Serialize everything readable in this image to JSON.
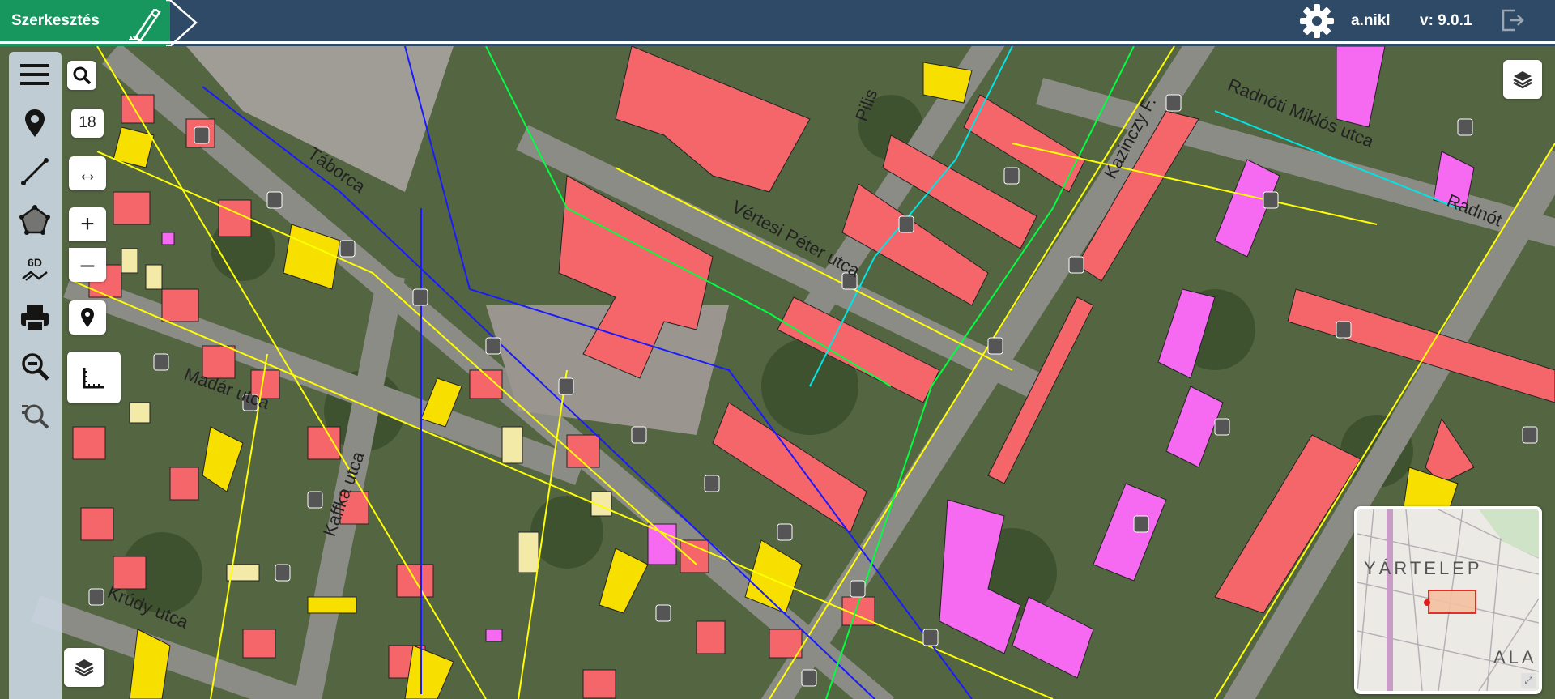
{
  "header": {
    "mode_label": "Szerkesztés",
    "user_name": "a.nikl",
    "version": "v: 9.0.1",
    "icons": {
      "mode": "pencil-ruler-icon",
      "settings": "gear-icon",
      "logout": "logout-icon"
    },
    "colors": {
      "bar": "#2f4a66",
      "mode_tab": "#17965e"
    }
  },
  "toolbar": {
    "tools": [
      {
        "name": "menu",
        "icon": "hamburger-menu-icon"
      },
      {
        "name": "point",
        "icon": "map-pin-icon"
      },
      {
        "name": "line",
        "icon": "line-draw-icon"
      },
      {
        "name": "polygon",
        "icon": "polygon-draw-icon"
      },
      {
        "name": "6d",
        "icon": "6d-icon",
        "label": "6D"
      },
      {
        "name": "print",
        "icon": "printer-icon"
      },
      {
        "name": "zoom-search",
        "icon": "zoom-search-icon"
      },
      {
        "name": "zoom-filter",
        "icon": "zoom-filter-icon"
      }
    ]
  },
  "controls": {
    "zoom_level": "18",
    "icons": {
      "search": "search-icon",
      "pan": "horizontal-arrows-icon",
      "zoom_in": "plus-icon",
      "zoom_out": "minus-icon",
      "locate": "location-pin-icon",
      "measure": "ruler-icon",
      "layers": "layers-icon"
    },
    "zoom_in_label": "+",
    "zoom_out_label": "–",
    "pan_label": "↔"
  },
  "map": {
    "street_labels": [
      "Táborca",
      "Vértesi Péter utca",
      "Pilis",
      "Kazinczy F.",
      "Radnóti Miklós utca",
      "Radnót",
      "Madár utca",
      "Kaffka utca",
      "Krúdy utca"
    ],
    "colors": {
      "building": "#f4666a",
      "public_building": "#f56af1",
      "yellow_building": "#f7e000",
      "pale_building": "#f3eaa8",
      "gas": "#ffff00",
      "water": "#1a1aff",
      "telecom": "#00ff40",
      "cable": "#00e5e5"
    }
  },
  "overview": {
    "labels": [
      "YÁRTELEP",
      "ALA"
    ]
  }
}
